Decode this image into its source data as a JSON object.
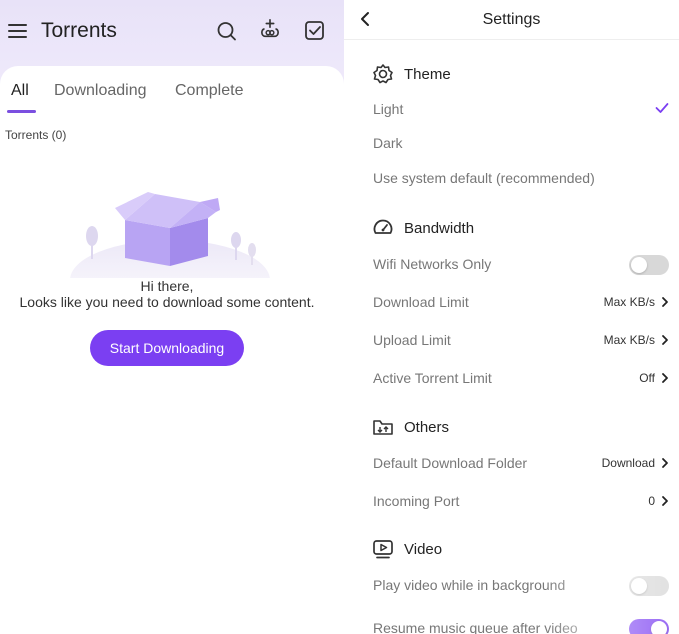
{
  "torrents_screen": {
    "title": "Torrents",
    "tabs": [
      {
        "label": "All",
        "active": true
      },
      {
        "label": "Downloading",
        "active": false
      },
      {
        "label": "Complete",
        "active": false
      }
    ],
    "torrent_count": "Torrents (0)",
    "empty_title": "Hi there,",
    "empty_subtitle": "Looks like you need to download some content.",
    "start_button": "Start Downloading",
    "icons": [
      "menu-icon",
      "search-icon",
      "add-torrent-icon",
      "select-icon"
    ]
  },
  "settings_screen": {
    "title": "Settings",
    "sections": {
      "theme": {
        "title": "Theme",
        "options": [
          "Light",
          "Dark",
          "Use system default (recommended)"
        ],
        "selected": "Light"
      },
      "bandwidth": {
        "title": "Bandwidth",
        "wifi_only": {
          "label": "Wifi Networks Only",
          "on": false
        },
        "download_limit": {
          "label": "Download Limit",
          "value": "Max KB/s"
        },
        "upload_limit": {
          "label": "Upload Limit",
          "value": "Max KB/s"
        },
        "active_torrent_limit": {
          "label": "Active Torrent Limit",
          "value": "Off"
        }
      },
      "others": {
        "title": "Others",
        "download_folder": {
          "label": "Default Download Folder",
          "value": "Download"
        },
        "incoming_port": {
          "label": "Incoming Port",
          "value": "0"
        }
      },
      "video": {
        "title": "Video",
        "play_background": {
          "label": "Play video while in background",
          "on": false
        },
        "resume_music": {
          "label": "Resume music queue after video",
          "on": true
        }
      }
    }
  },
  "colors": {
    "accent": "#7b3ff2",
    "header_bg": "#ebe5f9",
    "toggle_off": "#d8d8d8"
  }
}
